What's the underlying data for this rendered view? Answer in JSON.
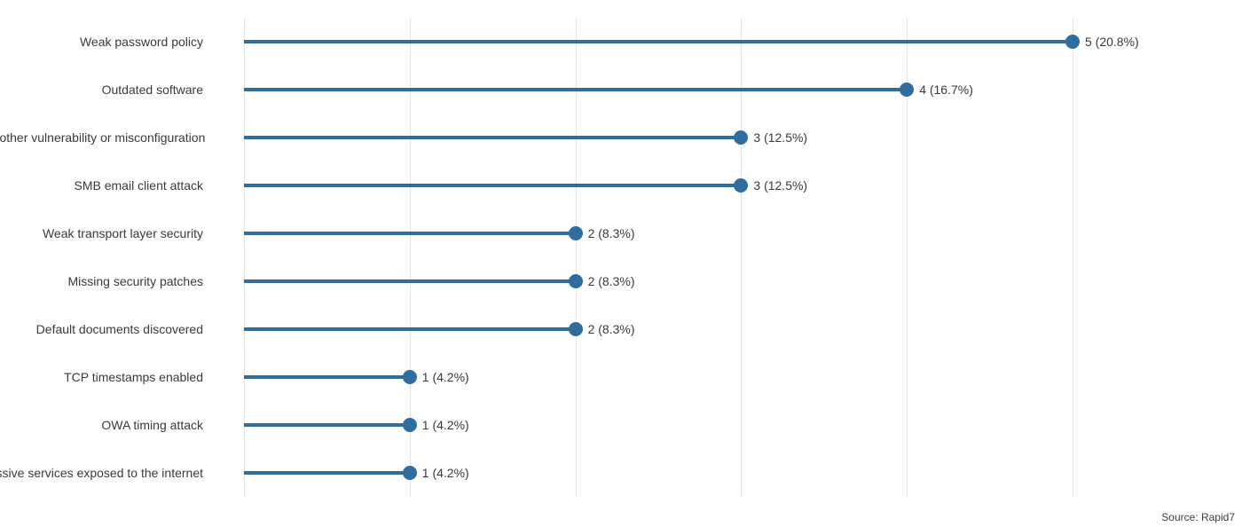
{
  "chart_data": {
    "type": "bar",
    "style": "lollipop",
    "categories": [
      "Weak password policy",
      "Outdated software",
      "Some other vulnerability or misconfiguration",
      "SMB email client attack",
      "Weak transport layer security",
      "Missing security patches",
      "Default documents discovered",
      "TCP timestamps enabled",
      "OWA timing attack",
      "Excessive services exposed to the internet"
    ],
    "values": [
      5,
      4,
      3,
      3,
      2,
      2,
      2,
      1,
      1,
      1
    ],
    "percent": [
      20.8,
      16.7,
      12.5,
      12.5,
      8.3,
      8.3,
      8.3,
      4.2,
      4.2,
      4.2
    ],
    "data_labels": [
      "5 (20.8%)",
      "4 (16.7%)",
      "3 (12.5%)",
      "3 (12.5%)",
      "2 (8.3%)",
      "2 (8.3%)",
      "2 (8.3%)",
      "1 (4.2%)",
      "1 (4.2%)",
      "1 (4.2%)"
    ],
    "xlim": [
      0,
      5
    ],
    "x_ticks": [
      0,
      1,
      2,
      3,
      4,
      5
    ],
    "title": "",
    "xlabel": "",
    "ylabel": ""
  },
  "color": "#2e6d9e",
  "source": "Source: Rapid7"
}
